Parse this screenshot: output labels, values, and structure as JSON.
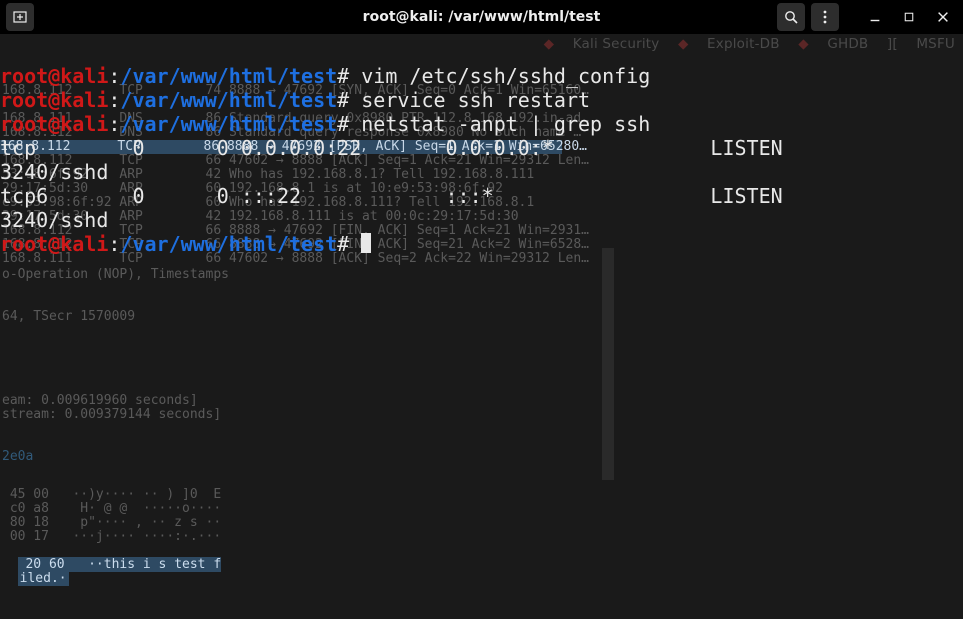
{
  "window": {
    "title": "root@kali: /var/www/html/test"
  },
  "prompt": {
    "user": "root@kali",
    "sep": ":",
    "path": "/var/www/html/test",
    "hash": "#"
  },
  "commands": {
    "c1": " vim /etc/ssh/sshd_config",
    "c2": " service ssh restart",
    "c3": " netstat -anpt | grep ssh"
  },
  "netstat": {
    "r1": "tcp        0      0 0.0.0.0:22       0.0.0.0:*             LISTEN    ",
    "r1b": "3240/sshd",
    "r2": "tcp6       0      0 :::22            :::*                  LISTEN    ",
    "r2b": "3240/sshd"
  },
  "bookmarks": {
    "b1": "Kali Security",
    "b2": "Exploit-DB",
    "b3": "GHDB",
    "b4": "MSFU"
  },
  "ghost": {
    "g1": "168.8.112      TCP        74 8888 → 47692 [SYN, ACK] Seq=0 Ack=1 Win=65160…",
    "g2": "168.8.111      DNS        86 Standard query 0x8980 PTR 112.8.168.192.in-ad…",
    "g3": "168.8.112      DNS        86 Standard query response 0x8980 No such name …",
    "g4": "168.8.112      TCP        86 8888 → 47692 [PSH, ACK] Seq=1 Ack=1 Win=65280…",
    "g5": "168.8.112      TCP        66 47602 → 8888 [ACK] Seq=1 Ack=21 Win=29312 Len…",
    "g6": "53:98:6f:92    ARP        42 Who has 192.168.8.1? Tell 192.168.8.111",
    "g7": "29:17:5d:30    ARP        60 192.168.8.1 is at 10:e9:53:98:6f:92",
    "g8": "e9:53:98:6f:92 ARP        60 Who has 192.168.8.111? Tell 192.168.8.1",
    "g9": "29:17:5d:30    ARP        42 192.168.8.111 is at 00:0c:29:17:5d:30",
    "g10": "168.8.112      TCP        66 8888 → 47692 [FIN, ACK] Seq=1 Ack=21 Win=2931…",
    "g11": "168.8.112      TCP        66 8888 → 47692 [FIN, ACK] Seq=21 Ack=2 Win=6528…",
    "g12": "168.8.111      TCP        66 47602 → 8888 [ACK] Seq=2 Ack=22 Win=29312 Len…",
    "nop": "o-Operation (NOP), Timestamps",
    "ts": "64, TSecr 1570009",
    "st1": "eam: 0.009619960 seconds]",
    "st2": "stream: 0.009379144 seconds]",
    "hex0": "2e0a",
    "hx1": " 45 00   ··)y···· ·· ) ]0  E ",
    "hx2": " c0 a8    H· @ @  ·····o····",
    "hx3": " 80 18    p\"···· , ·· z s ··",
    "hx4": " 00 17   ···j···· ····:·.···",
    "hx5": " 20 60   ··",
    "hx5b": "this i s test f",
    "hx6": "iled.·"
  }
}
